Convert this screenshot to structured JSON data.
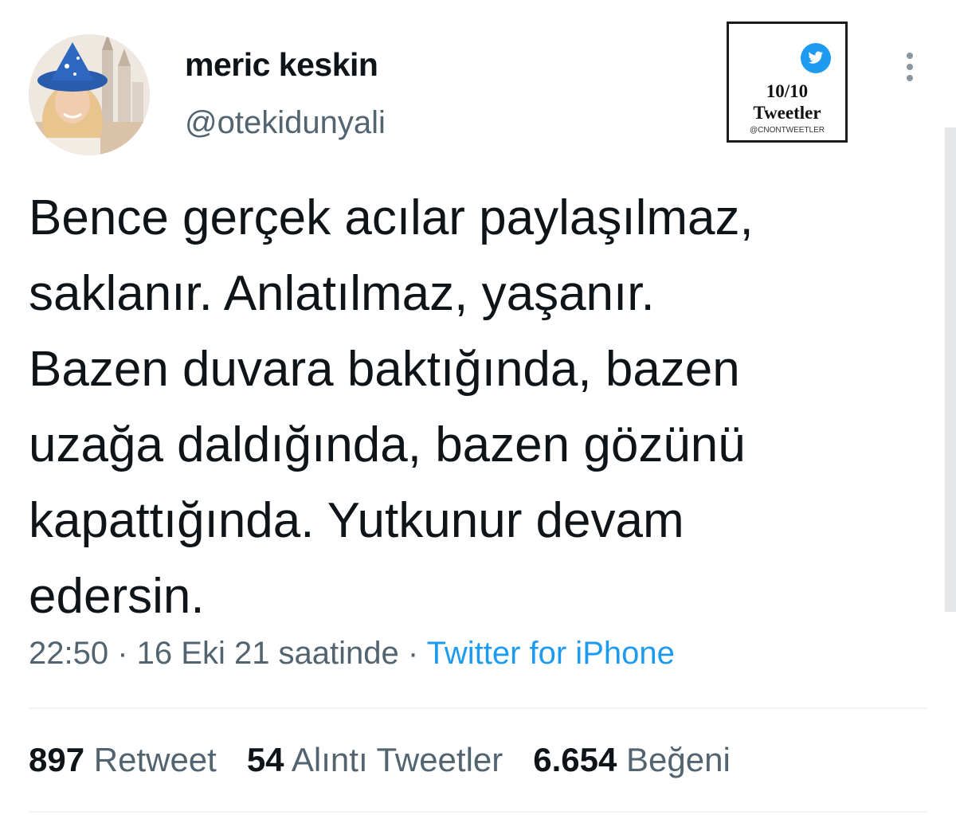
{
  "tweet": {
    "author": {
      "display_name": "meric keskin",
      "handle": "@otekidunyali",
      "avatar_icon": "profile-photo"
    },
    "text_lines": [
      "Bence gerçek acılar paylaşılmaz,",
      "saklanır. Anlatılmaz, yaşanır.",
      "Bazen duvara baktığında, bazen",
      "uzağa daldığında, bazen gözünü",
      "kapattığında. Yutkunur devam",
      "edersin."
    ],
    "meta": {
      "time": "22:50",
      "separator1": " · ",
      "date": "16 Eki 21 saatinde",
      "separator2": " · ",
      "source": "Twitter for iPhone"
    },
    "stats": {
      "retweets_count": "897",
      "retweets_label": "Retweet",
      "quotes_count": "54",
      "quotes_label": "Alıntı Tweetler",
      "likes_count": "6.654",
      "likes_label": "Beğeni"
    }
  },
  "watermark": {
    "count": "10/10",
    "word": "Tweetler",
    "handle": "@CNONTWEETLER",
    "icon": "twitter-bird-icon"
  },
  "colors": {
    "text": "#0f1419",
    "secondary": "#536471",
    "link": "#1d9bf0",
    "divider": "#eff3f4"
  }
}
